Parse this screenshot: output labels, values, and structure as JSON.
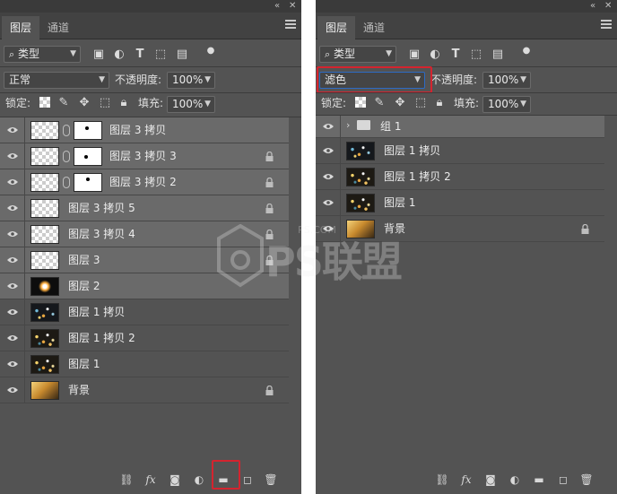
{
  "left_panel": {
    "tabs": [
      "图层",
      "通道"
    ],
    "filter": {
      "label": "类型"
    },
    "blend_mode": "正常",
    "opacity_label": "不透明度:",
    "opacity_value": "100%",
    "lock_label": "锁定:",
    "fill_label": "填充:",
    "fill_value": "100%",
    "layers": [
      {
        "name": "图层 3 拷贝",
        "thumb": "checker",
        "mask": true,
        "locked": false,
        "selected": true
      },
      {
        "name": "图层 3 拷贝 3",
        "thumb": "checker",
        "mask": true,
        "locked": true,
        "selected": true
      },
      {
        "name": "图层 3 拷贝 2",
        "thumb": "checker",
        "mask": true,
        "locked": true,
        "selected": true
      },
      {
        "name": "图层 3 拷贝 5",
        "thumb": "checker",
        "mask": false,
        "locked": true,
        "selected": true
      },
      {
        "name": "图层 3 拷贝 4",
        "thumb": "checker",
        "mask": false,
        "locked": true,
        "selected": true
      },
      {
        "name": "图层 3",
        "thumb": "checker",
        "mask": false,
        "locked": true,
        "selected": true
      },
      {
        "name": "图层 2",
        "thumb": "flare",
        "mask": false,
        "locked": false,
        "selected": true
      },
      {
        "name": "图层 1 拷贝",
        "thumb": "bokeh-blue",
        "mask": false,
        "locked": false,
        "selected": false
      },
      {
        "name": "图层 1 拷贝 2",
        "thumb": "bokeh",
        "mask": false,
        "locked": false,
        "selected": false
      },
      {
        "name": "图层 1",
        "thumb": "bokeh",
        "mask": false,
        "locked": false,
        "selected": false
      },
      {
        "name": "背景",
        "thumb": "photo",
        "mask": false,
        "locked": true,
        "selected": false
      }
    ],
    "highlighted_button": "new-group-button"
  },
  "right_panel": {
    "tabs": [
      "图层",
      "通道"
    ],
    "filter": {
      "label": "类型"
    },
    "blend_mode": "滤色",
    "opacity_label": "不透明度:",
    "opacity_value": "100%",
    "lock_label": "锁定:",
    "fill_label": "填充:",
    "fill_value": "100%",
    "group": {
      "name": "组 1"
    },
    "layers": [
      {
        "name": "图层 1 拷贝",
        "thumb": "bokeh-blue",
        "locked": false
      },
      {
        "name": "图层 1 拷贝 2",
        "thumb": "bokeh",
        "locked": false
      },
      {
        "name": "图层 1",
        "thumb": "bokeh",
        "locked": false
      },
      {
        "name": "背景",
        "thumb": "photo",
        "locked": true
      }
    ],
    "highlighted_field": "blend-mode-select"
  },
  "watermark": {
    "small": "PS.COM",
    "large": "PS联盟"
  },
  "colors": {
    "panel": "#535353",
    "selected": "#6a6a6a",
    "highlight": "#d4242f",
    "field_focus": "#2d6bc4"
  }
}
